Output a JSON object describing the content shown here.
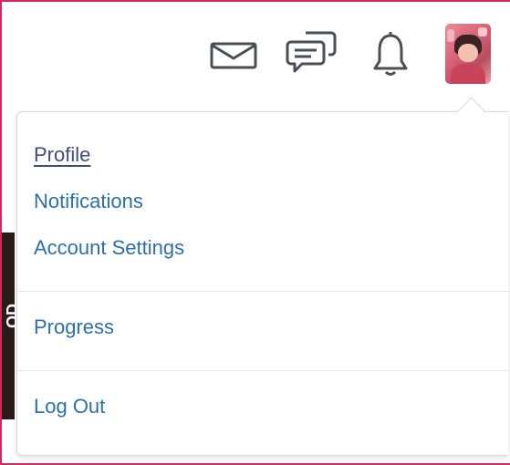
{
  "header": {
    "icons": [
      {
        "name": "mail-icon",
        "label": "mail"
      },
      {
        "name": "chat-icon",
        "label": "message"
      },
      {
        "name": "bell-icon",
        "label": "notifications"
      }
    ],
    "avatar": {
      "name": "avatar"
    }
  },
  "background": {
    "partial_text": "OD"
  },
  "menu": {
    "groups": [
      {
        "items": [
          {
            "label": "Profile",
            "active": true
          },
          {
            "label": "Notifications",
            "active": false
          },
          {
            "label": "Account Settings",
            "active": false
          }
        ]
      },
      {
        "items": [
          {
            "label": "Progress",
            "active": false
          }
        ]
      },
      {
        "items": [
          {
            "label": "Log Out",
            "active": false
          }
        ]
      }
    ]
  },
  "colors": {
    "frame_accent": "#d12a58",
    "link": "#2f6fa5",
    "link_active": "#3e4d7a",
    "divider": "#e3e6ea"
  }
}
